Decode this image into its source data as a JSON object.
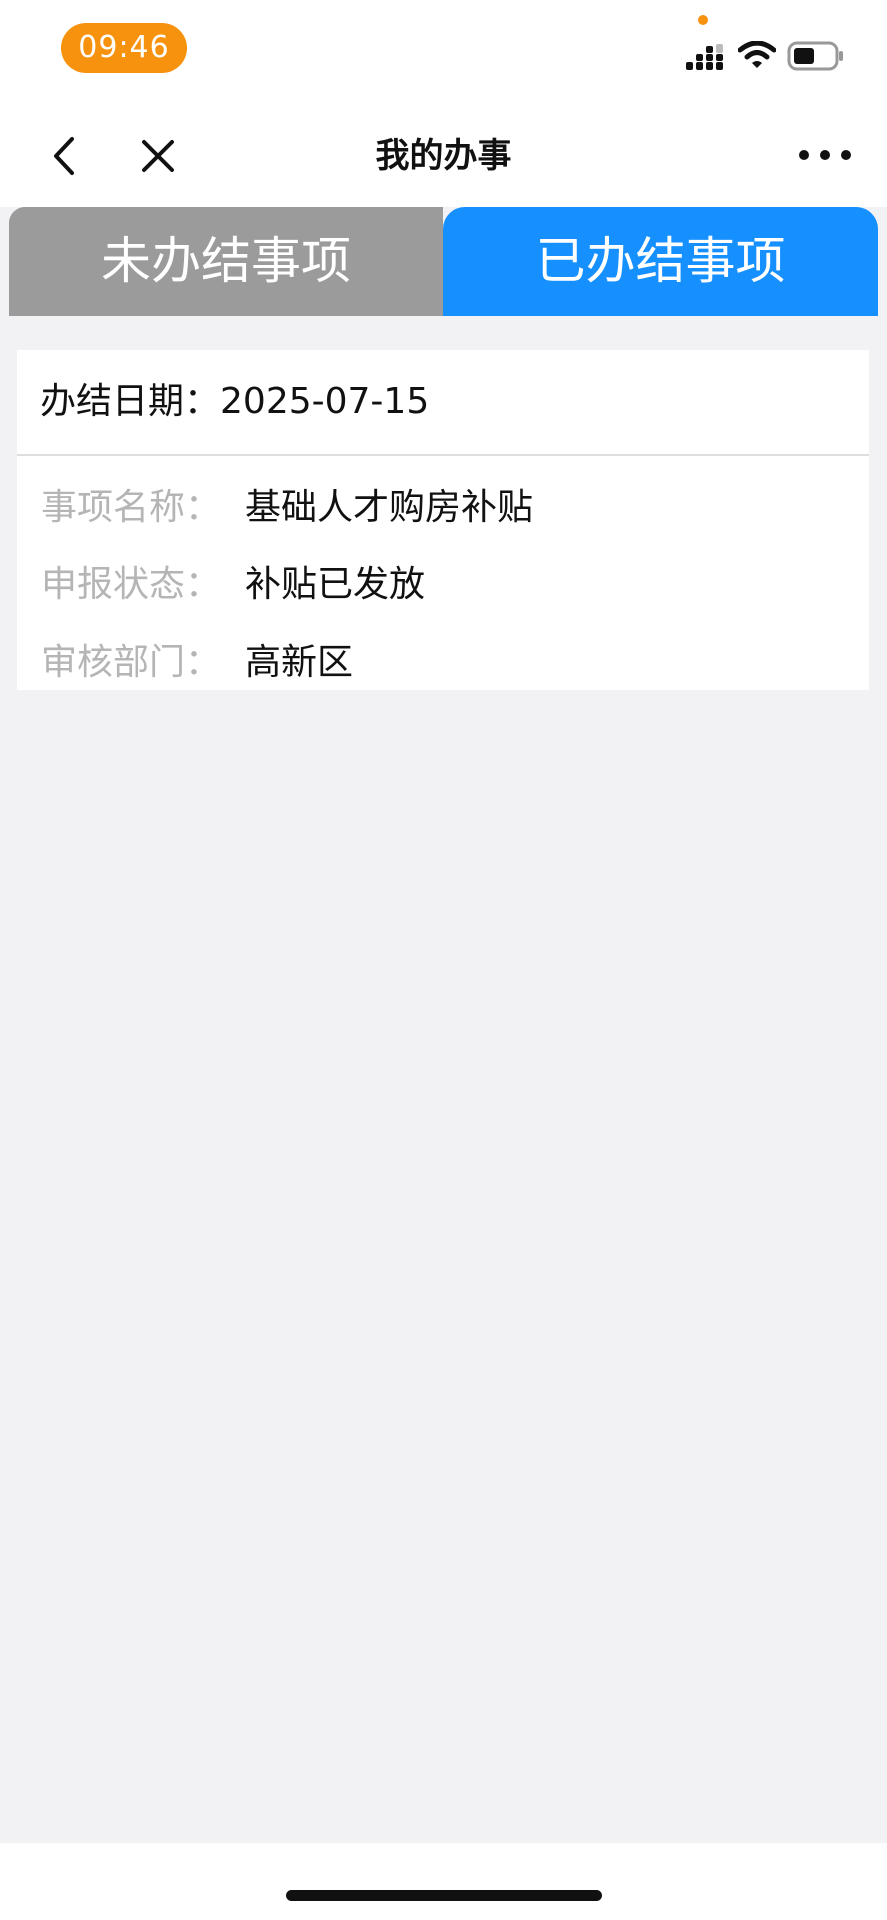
{
  "status_bar": {
    "time": "09:46",
    "icons": [
      "signal-icon",
      "wifi-icon",
      "battery-icon"
    ],
    "accent_color": "#f7920f"
  },
  "nav": {
    "title": "我的办事",
    "back_icon": "back-icon",
    "close_icon": "close-icon",
    "more_icon": "more-icon"
  },
  "tabs": [
    {
      "label": "未办结事项",
      "active": false,
      "color": "#9b9b9b"
    },
    {
      "label": "已办结事项",
      "active": true,
      "color": "#1790ff"
    }
  ],
  "record": {
    "date_label": "办结日期：",
    "date_value": "2025-07-15",
    "fields": [
      {
        "label": "事项名称：",
        "value": "基础人才购房补贴"
      },
      {
        "label": "申报状态：",
        "value": "补贴已发放"
      },
      {
        "label": "审核部门：",
        "value": "高新区"
      }
    ]
  }
}
